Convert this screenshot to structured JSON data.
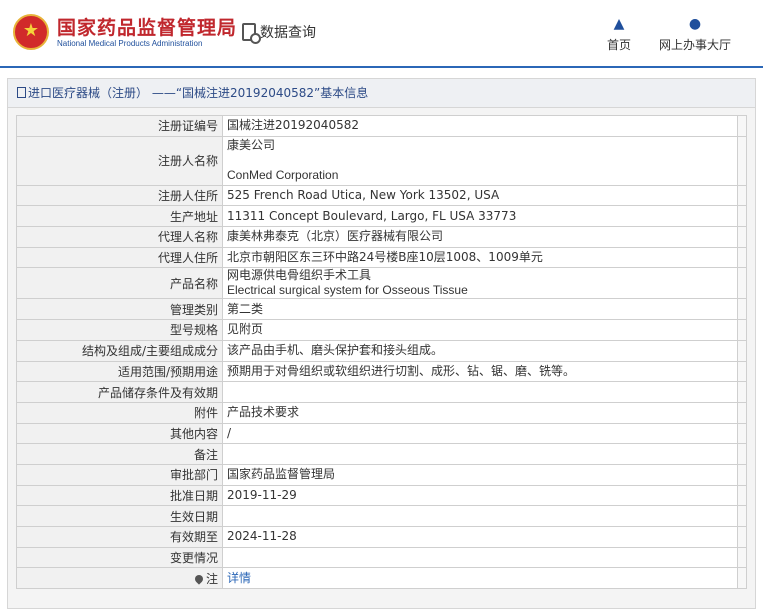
{
  "header": {
    "site_title": "国家药品监督管理局",
    "site_subtitle": "National Medical Products Administration",
    "nav_query": "数据查询",
    "nav_home": "首页",
    "nav_hall": "网上办事大厅"
  },
  "panel": {
    "title": "进口医疗器械（注册） ——“国械注进20192040582”基本信息"
  },
  "rows": [
    {
      "label": "注册证编号",
      "value": "国械注进20192040582"
    },
    {
      "label": "注册人名称",
      "value_lines": [
        "康美公司",
        "",
        "ConMed Corporation"
      ]
    },
    {
      "label": "注册人住所",
      "value": "525 French Road Utica, New York 13502, USA"
    },
    {
      "label": "生产地址",
      "value": "11311 Concept Boulevard, Largo, FL USA 33773"
    },
    {
      "label": "代理人名称",
      "value": "康美林弗泰克（北京）医疗器械有限公司"
    },
    {
      "label": "代理人住所",
      "value": "北京市朝阳区东三环中路24号楼B座10层1008、1009单元"
    },
    {
      "label": "产品名称",
      "value_lines": [
        "网电源供电骨组织手术工具",
        "Electrical surgical system for Osseous Tissue"
      ]
    },
    {
      "label": "管理类别",
      "value": "第二类"
    },
    {
      "label": "型号规格",
      "value": "见附页"
    },
    {
      "label": "结构及组成/主要组成成分",
      "value": "该产品由手机、磨头保护套和接头组成。"
    },
    {
      "label": "适用范围/预期用途",
      "value": "预期用于对骨组织或软组织进行切割、成形、钻、锯、磨、铣等。"
    },
    {
      "label": "产品储存条件及有效期",
      "value": ""
    },
    {
      "label": "附件",
      "value": "产品技术要求"
    },
    {
      "label": "其他内容",
      "value": "/"
    },
    {
      "label": "备注",
      "value": ""
    },
    {
      "label": "审批部门",
      "value": "国家药品监督管理局"
    },
    {
      "label": "批准日期",
      "value": "2019-11-29"
    },
    {
      "label": "生效日期",
      "value": ""
    },
    {
      "label": "有效期至",
      "value": "2024-11-28"
    },
    {
      "label": "变更情况",
      "value": ""
    },
    {
      "label": "注",
      "value": "详情",
      "link": true
    }
  ]
}
